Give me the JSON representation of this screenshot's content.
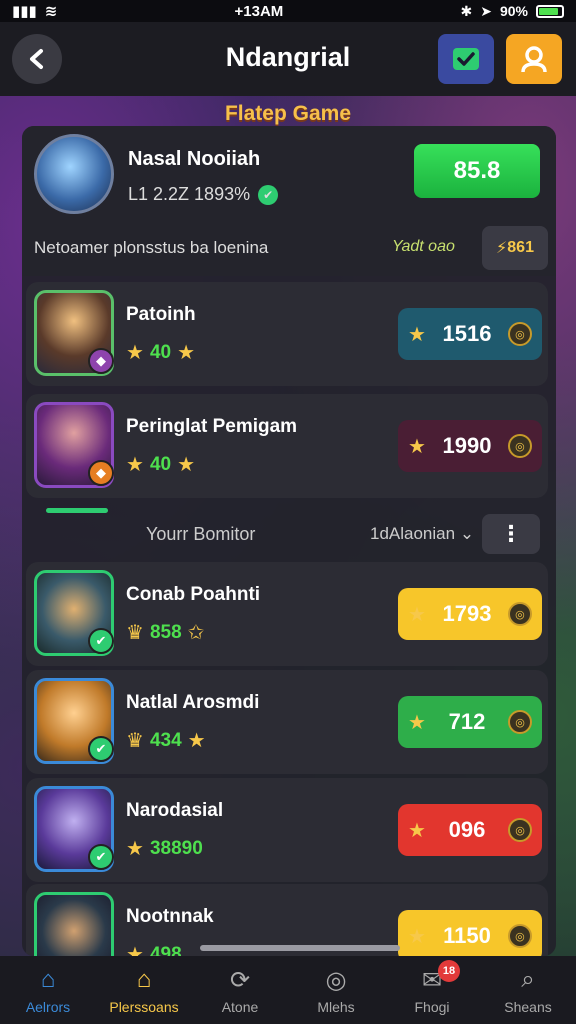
{
  "status_bar": {
    "time": "+13AM",
    "battery": "90%"
  },
  "header": {
    "title": "Ndangrial"
  },
  "banner": {
    "title": "Flatep Game"
  },
  "profile": {
    "name": "Nasal Nooiiah",
    "subtitle": "L1 2.2Z 1893%",
    "score": "85.8",
    "description": "Netoamer plonsstus ba loenina",
    "tag": "Yadt oao",
    "coins": "861"
  },
  "players": [
    {
      "name": "Patoinh",
      "sub": "40",
      "reward": "1516",
      "reward_color": "#1f5a6e",
      "border_color": "#5ac06a",
      "badge_color": "#8e44ad",
      "avatar_bg": "radial-gradient(circle at 50% 35%, #f0c080 0%, #5a3a2a 55%, #2a2a3a 100%)"
    },
    {
      "name": "Peringlat Pemigam",
      "sub": "40",
      "reward": "1990",
      "reward_color": "#4a1e34",
      "border_color": "#8a4ac0",
      "badge_color": "#e67e22",
      "avatar_bg": "radial-gradient(circle at 50% 35%, #e0a0a0 0%, #6a2a7a 55%, #2a1a3a 100%)"
    }
  ],
  "section": {
    "title": "Yourr Bomitor",
    "filter": "1dAlaonian",
    "more": "⋮"
  },
  "ranked": [
    {
      "name": "Conab Poahnti",
      "sub": "858",
      "reward": "1793",
      "reward_color": "#f7c62a",
      "reward_text": "#ffffff",
      "border_color": "#2ecc71",
      "badge_color": "#2ecc71",
      "avatar_bg": "radial-gradient(circle at 50% 45%, #e0b070 0%, #3a5a6a 55%, #1a2a2a 100%)"
    },
    {
      "name": "Natlal Arosmdi",
      "sub": "434",
      "reward": "712",
      "reward_color": "#2eae4a",
      "reward_text": "#ffffff",
      "border_color": "#3b8ad8",
      "badge_color": "#2ecc71",
      "avatar_bg": "radial-gradient(circle at 50% 40%, #ffd090 0%, #c07a2a 55%, #3a2a1a 100%)"
    },
    {
      "name": "Narodasial",
      "sub": "38890",
      "reward": "096",
      "reward_color": "#e2362e",
      "reward_text": "#ffffff",
      "border_color": "#3b8ad8",
      "badge_color": "#2ecc71",
      "avatar_bg": "radial-gradient(circle at 50% 40%, #c0b0f0 0%, #5a3a9a 55%, #1a1a3a 100%)"
    },
    {
      "name": "Nootnnak",
      "sub": "498",
      "reward": "1150",
      "reward_color": "#f7c62a",
      "reward_text": "#ffffff",
      "border_color": "#2ecc71",
      "badge_color": "#2ecc71",
      "avatar_bg": "radial-gradient(circle at 50% 45%, #d0a070 0%, #2a3a4a 55%, #1a1a2a 100%)"
    }
  ],
  "bottom_nav": [
    {
      "label": "Aelrors",
      "icon": "home-icon",
      "active": false
    },
    {
      "label": "Plerssoans",
      "icon": "home-icon",
      "active": true
    },
    {
      "label": "Atone",
      "icon": "refresh-icon",
      "active": false
    },
    {
      "label": "Mlehs",
      "icon": "target-icon",
      "active": false
    },
    {
      "label": "Fhogi",
      "icon": "inbox-icon",
      "active": false,
      "badge": "18"
    },
    {
      "label": "Sheans",
      "icon": "search-icon",
      "active": false
    }
  ]
}
